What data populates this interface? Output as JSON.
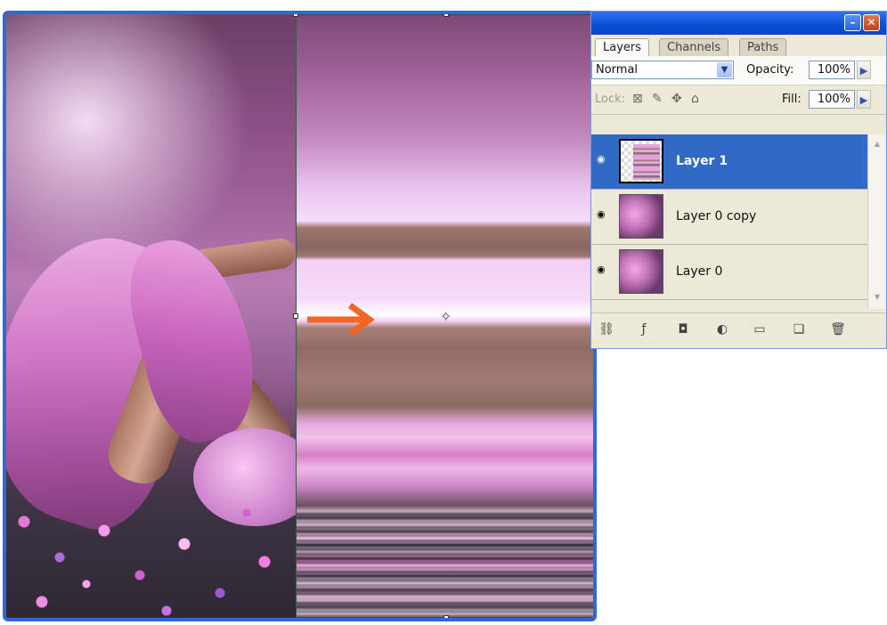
{
  "layers_panel": {
    "tabs": [
      {
        "label": "Layers",
        "active": true
      },
      {
        "label": "Channels",
        "active": false
      },
      {
        "label": "Paths",
        "active": false
      }
    ],
    "blend_mode": "Normal",
    "opacity_label": "Opacity:",
    "opacity_value": "100%",
    "lock_label": "Lock:",
    "fill_label": "Fill:",
    "fill_value": "100%",
    "layers": [
      {
        "name": "Layer 1",
        "selected": true,
        "visible": true
      },
      {
        "name": "Layer 0 copy",
        "selected": false,
        "visible": true
      },
      {
        "name": "Layer 0",
        "selected": false,
        "visible": true
      }
    ],
    "bottom_icons": [
      "link-icon",
      "layer-style-icon",
      "layer-mask-icon",
      "adjustment-layer-icon",
      "new-group-icon",
      "new-layer-icon",
      "trash-icon"
    ]
  },
  "canvas": {
    "annotation_arrow_color": "#f26522",
    "frame_color": "#2e6ad6"
  },
  "colors": {
    "titlebar": "#0a4ed6",
    "selection": "#316ac5",
    "panel_bg": "#ece9d8"
  }
}
